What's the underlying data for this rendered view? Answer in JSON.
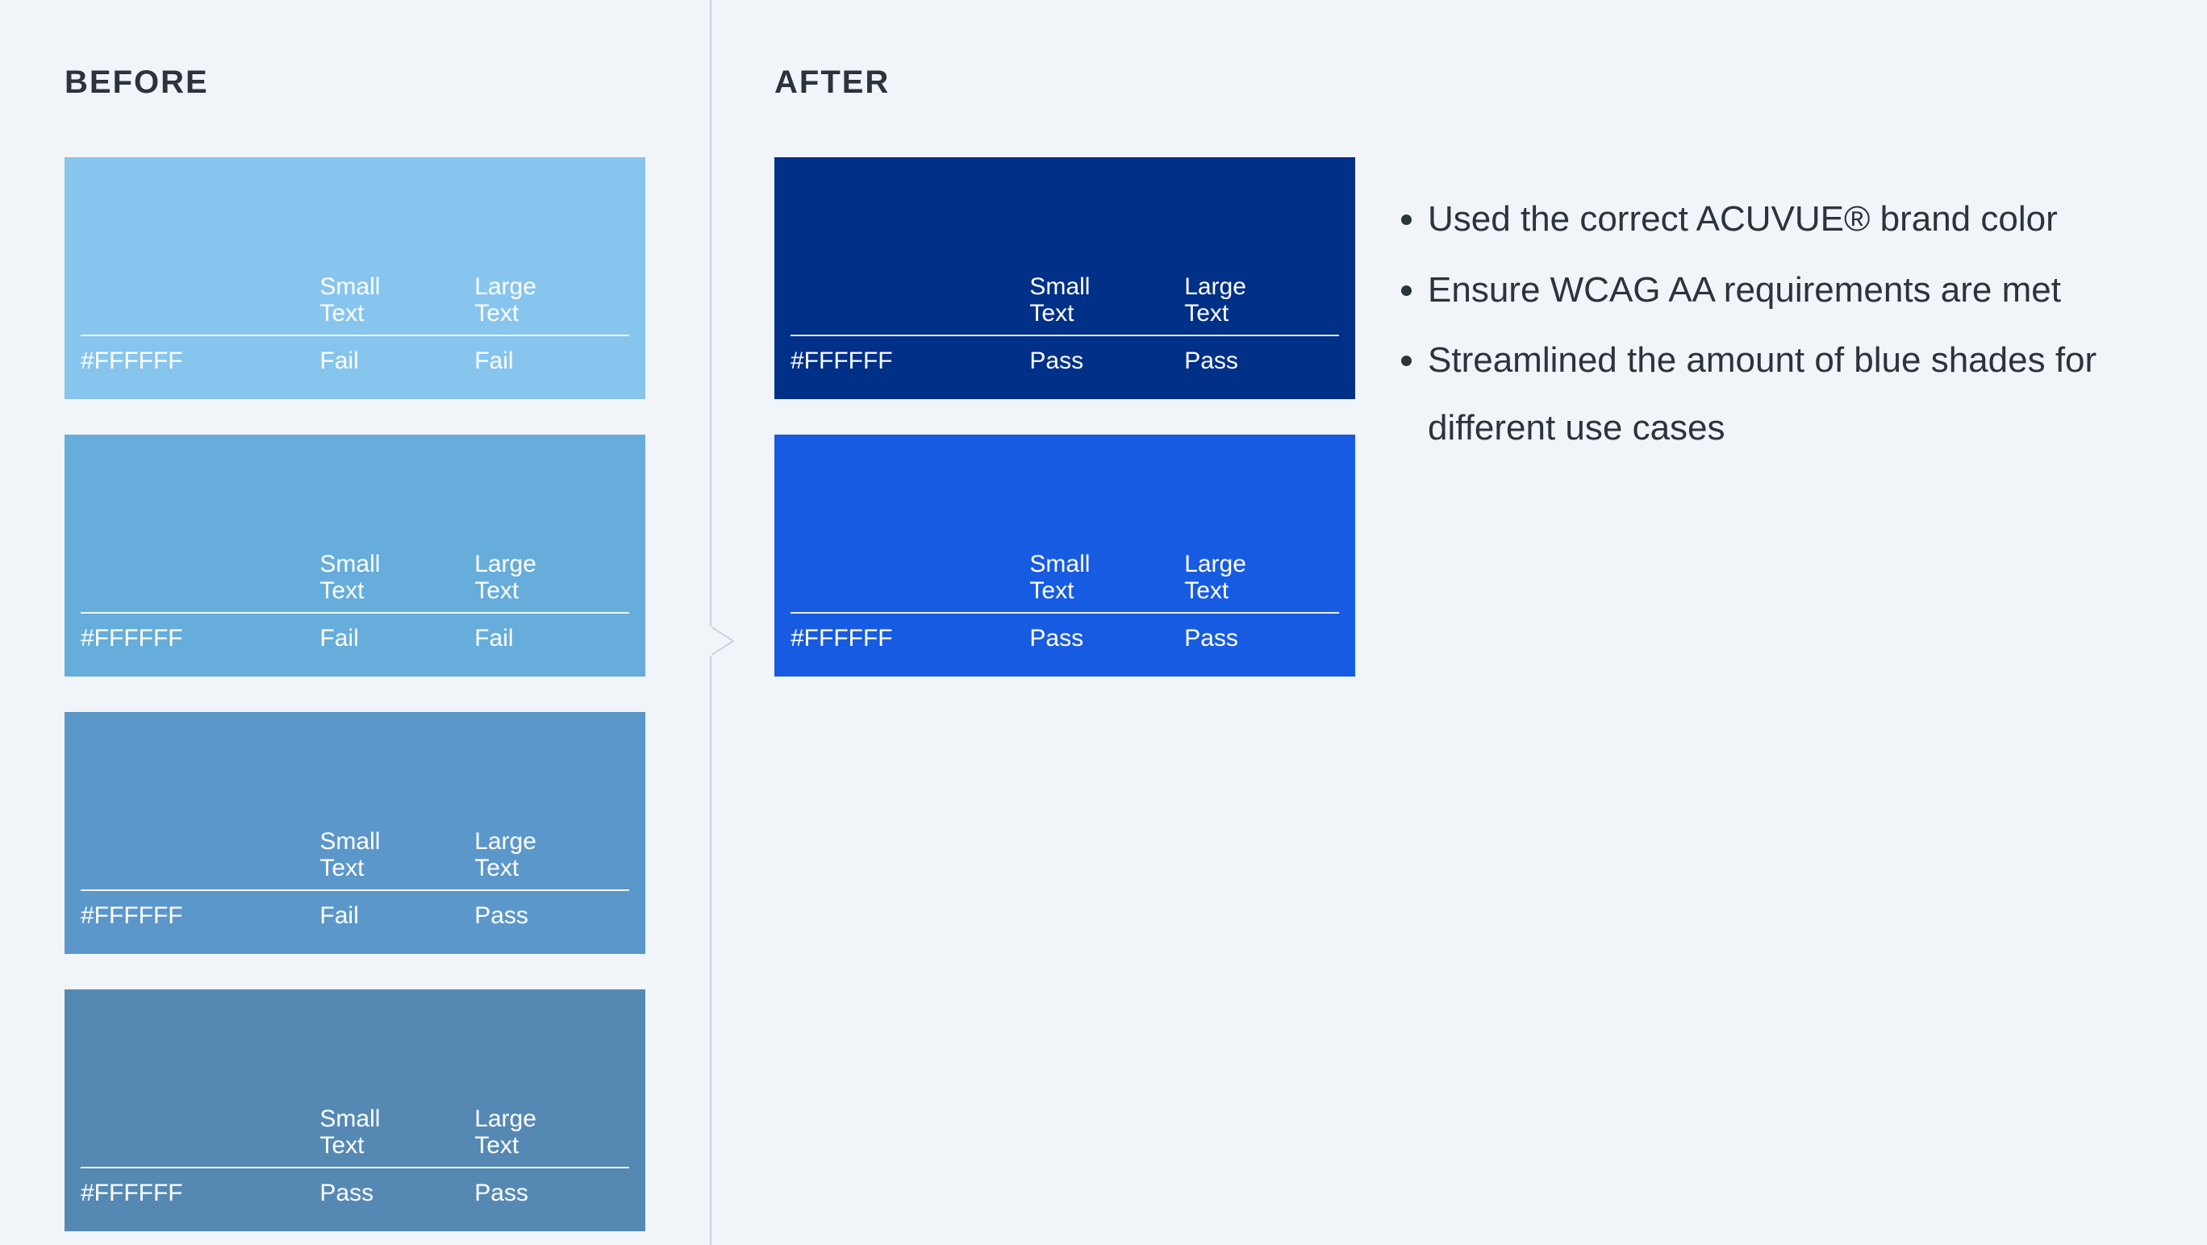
{
  "headings": {
    "before": "BEFORE",
    "after": "AFTER"
  },
  "labels": {
    "small_text": "Small\nText",
    "large_text": "Large\nText"
  },
  "before_swatches": [
    {
      "bg": "#87C5EE",
      "hex": "#FFFFFF",
      "small": "Fail",
      "large": "Fail"
    },
    {
      "bg": "#66ADDB",
      "hex": "#FFFFFF",
      "small": "Fail",
      "large": "Fail"
    },
    {
      "bg": "#5B97CB",
      "hex": "#FFFFFF",
      "small": "Fail",
      "large": "Pass"
    },
    {
      "bg": "#5589B4",
      "hex": "#FFFFFF",
      "small": "Pass",
      "large": "Pass"
    }
  ],
  "after_swatches": [
    {
      "bg": "#003087",
      "hex": "#FFFFFF",
      "small": "Pass",
      "large": "Pass"
    },
    {
      "bg": "#185BE3",
      "hex": "#FFFFFF",
      "small": "Pass",
      "large": "Pass"
    }
  ],
  "notes": [
    "Used the correct ACUVUE® brand color",
    "Ensure WCAG AA requirements are met",
    "Streamlined the amount of blue shades for different use cases"
  ]
}
